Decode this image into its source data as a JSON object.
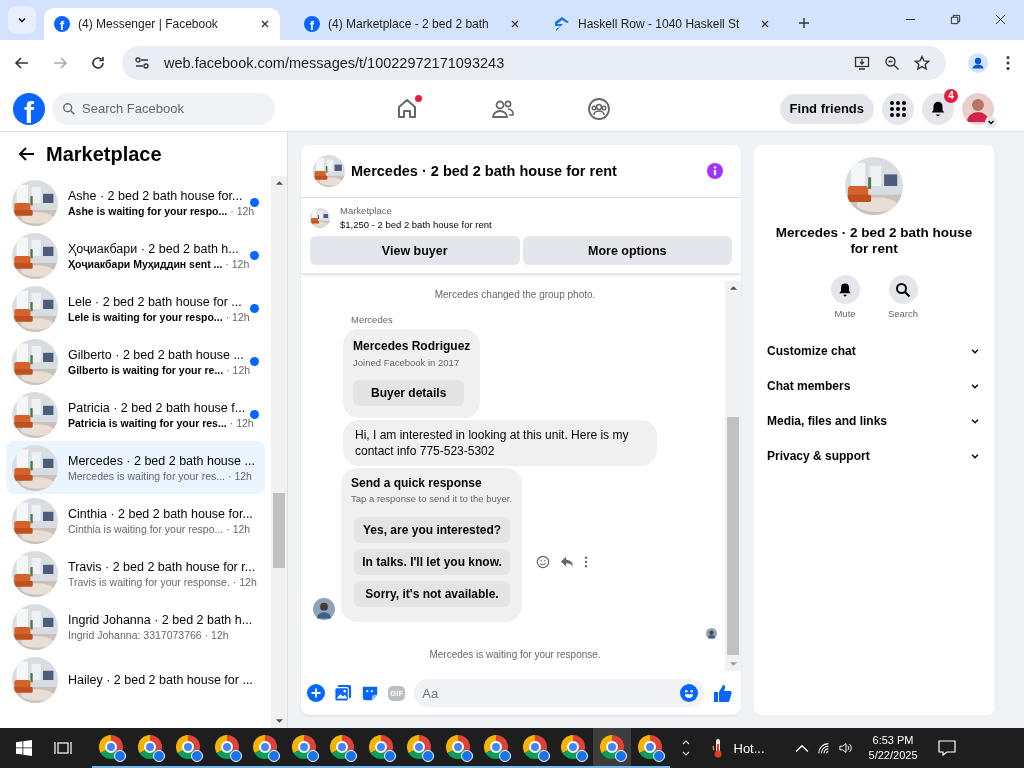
{
  "browser": {
    "tabs": [
      {
        "title": "(4) Messenger | Facebook",
        "favicon": "f",
        "selected": true
      },
      {
        "title": "(4) Marketplace - 2 bed 2 bath",
        "favicon": "f",
        "selected": false
      },
      {
        "title": "Haskell Row - 1040 Haskell St",
        "selected": false
      }
    ],
    "url": "web.facebook.com/messages/t/10022972171093243"
  },
  "logo": "f",
  "header": {
    "search_placeholder": "Search Facebook",
    "nav": [
      {
        "kind": "home",
        "dot": true
      },
      {
        "kind": "friends",
        "dot": false
      },
      {
        "kind": "groups",
        "dot": false
      }
    ],
    "find_friends": "Find friends",
    "notifications": "4"
  },
  "sidebar": {
    "title": "Marketplace",
    "conversations": [
      {
        "title": "Ashe · 2 bed 2 bath house for...",
        "preview": "Ashe is waiting for your respo...",
        "time": "· 12h",
        "unread": true,
        "selected": false
      },
      {
        "title": "Ҳоҷиакбари · 2 bed 2 bath h...",
        "preview": "Ҳоҷиакбари Муҳиддин sent ...",
        "time": "· 12h",
        "unread": true,
        "selected": false
      },
      {
        "title": "Lele · 2 bed 2 bath house for ...",
        "preview": "Lele is waiting for your respo...",
        "time": "· 12h",
        "unread": true,
        "selected": false
      },
      {
        "title": "Gilberto · 2 bed 2 bath house ...",
        "preview": "Gilberto is waiting for your re...",
        "time": "· 12h",
        "unread": true,
        "selected": false
      },
      {
        "title": "Patricia · 2 bed 2 bath house f...",
        "preview": "Patricia is waiting for your res...",
        "time": "· 12h",
        "unread": true,
        "selected": false
      },
      {
        "title": "Mercedes · 2 bed 2 bath house ...",
        "preview": "Mercedes is waiting for your res...",
        "time": "· 12h",
        "unread": false,
        "selected": true
      },
      {
        "title": "Cinthia · 2 bed 2 bath house for...",
        "preview": "Cinthia is waiting for your respo...",
        "time": "· 12h",
        "unread": false,
        "selected": false
      },
      {
        "title": "Travis · 2 bed 2 bath house for r...",
        "preview": "Travis is waiting for your response.",
        "time": "· 12h",
        "unread": false,
        "selected": false
      },
      {
        "title": "Ingrid Johanna · 2 bed 2 bath h...",
        "preview": "Ingrid Johanna: 3317073766",
        "time": "· 12h",
        "unread": false,
        "selected": false
      },
      {
        "title": "Hailey · 2 bed 2 bath house for ...",
        "unread": false,
        "selected": false
      }
    ]
  },
  "chat": {
    "title": "Mercedes · 2 bed 2 bath house for rent",
    "listing": {
      "label": "Marketplace",
      "text": "$1,250 - 2 bed 2 bath house for rent"
    },
    "buttons": [
      "View buyer",
      "More options"
    ],
    "messages": [
      {
        "kind": "system",
        "text": "Mercedes changed the group photo."
      },
      {
        "kind": "sender",
        "text": "Mercedes"
      },
      {
        "kind": "profile",
        "name": "Mercedes Rodriguez",
        "subtitle": "Joined Facebook in 2017",
        "button": "Buyer details"
      },
      {
        "kind": "bubble",
        "text": "Hi, I am interested in looking at this unit. Here is my contact info 775-523-5302"
      },
      {
        "kind": "quick",
        "title": "Send a quick response",
        "subtitle": "Tap a response to send it to the buyer.",
        "options": [
          "Yes, are you interested?",
          "In talks. I'll let you know.",
          "Sorry, it's not available."
        ]
      },
      {
        "kind": "seen"
      },
      {
        "kind": "system",
        "text": "Mercedes is waiting for your response."
      }
    ],
    "composer": {
      "gif": "GIF",
      "placeholder": "Aa"
    }
  },
  "details": {
    "title": "Mercedes · 2 bed 2 bath house for rent",
    "actions": [
      {
        "kind": "mute",
        "label": "Mute"
      },
      {
        "kind": "search",
        "label": "Search"
      }
    ],
    "sections": [
      {
        "label": "Customize chat",
        "expanded": false
      },
      {
        "label": "Chat members",
        "expanded": false
      },
      {
        "label": "Media, files and links",
        "expanded": false
      },
      {
        "label": "Privacy & support",
        "expanded": false
      }
    ]
  },
  "taskbar": {
    "apps": [
      {
        "selected": false
      },
      {
        "selected": false
      },
      {
        "selected": false
      },
      {
        "selected": false
      },
      {
        "selected": false
      },
      {
        "selected": false
      },
      {
        "selected": false
      },
      {
        "selected": false
      },
      {
        "selected": false
      },
      {
        "selected": false
      },
      {
        "selected": false
      },
      {
        "selected": false
      },
      {
        "selected": false
      },
      {
        "selected": true
      },
      {
        "selected": false
      }
    ],
    "weather": "Hot...",
    "time": "6:53 PM",
    "date": "5/22/2025"
  }
}
